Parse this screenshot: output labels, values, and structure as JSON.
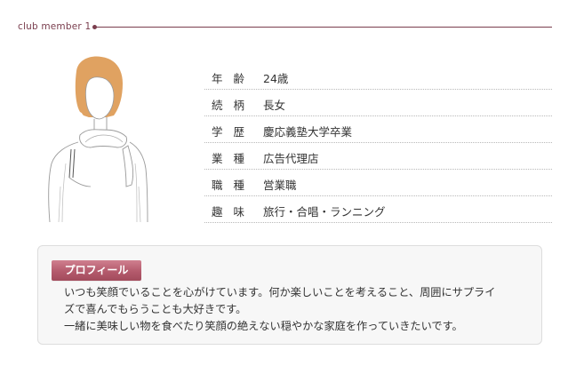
{
  "section": {
    "title": "club member 1",
    "accent_color": "#7a3e4e"
  },
  "avatar": {
    "icon": "person-silhouette-icon",
    "hair_color": "#e0a261"
  },
  "info": {
    "rows": [
      {
        "label": "年 齢",
        "value": "24歳"
      },
      {
        "label": "続 柄",
        "value": "長女"
      },
      {
        "label": "学 歴",
        "value": "慶応義塾大学卒業"
      },
      {
        "label": "業 種",
        "value": "広告代理店"
      },
      {
        "label": "職 種",
        "value": "営業職"
      },
      {
        "label": "趣 味",
        "value": "旅行・合唱・ランニング"
      }
    ]
  },
  "profile": {
    "badge_label": "プロフィール",
    "badge_color": "#b45a6c",
    "lines": [
      "いつも笑顔でいることを心がけています。何か楽しいことを考えること、周囲にサプライ",
      "ズで喜んでもらうことも大好きです。",
      "一緒に美味しい物を食べたり笑顔の絶えない穏やかな家庭を作っていきたいです。"
    ]
  }
}
